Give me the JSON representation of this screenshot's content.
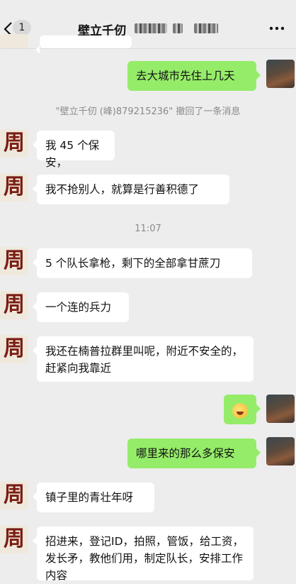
{
  "header": {
    "back_badge": "1",
    "title": "壁立千仞"
  },
  "recall_notice": "\"壁立千仞 (峰)879215236\" 撤回了一条消息",
  "time_divider": "11:07",
  "contact_avatar_glyph": "周",
  "messages": [
    {
      "side": "right",
      "text": "去大城市先住上几天"
    },
    {
      "side": "left",
      "text": "我 45 个保安，"
    },
    {
      "side": "left",
      "text": "我不抢别人，就算是行善积德了"
    },
    {
      "side": "left",
      "text": "5 个队长拿枪，剩下的全部拿甘蔗刀"
    },
    {
      "side": "left",
      "text": "一个连的兵力"
    },
    {
      "side": "left",
      "text": "我还在楠普拉群里叫呢，附近不安全的，赶紧向我靠近"
    },
    {
      "side": "right",
      "text": "",
      "emoji": "grin-sweat-emoji"
    },
    {
      "side": "right",
      "text": "哪里来的那么多保安"
    },
    {
      "side": "left",
      "text": "镇子里的青壮年呀"
    },
    {
      "side": "left",
      "text": "招进来，登记ID，拍照，管饭，给工资，发长矛，教他们用，制定队长，安排工作内容"
    }
  ]
}
